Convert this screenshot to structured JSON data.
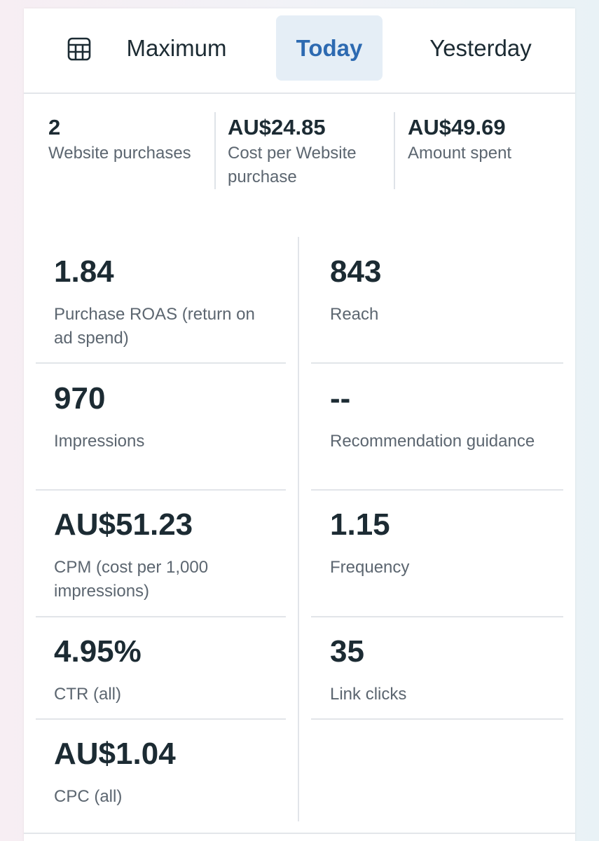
{
  "tabs": {
    "calendar_icon": "calendar-icon",
    "items": [
      {
        "label": "Maximum",
        "selected": false
      },
      {
        "label": "Today",
        "selected": true
      },
      {
        "label": "Yesterday",
        "selected": false
      }
    ],
    "selected_bg": "#e5eef6",
    "selected_color": "#2d6ab1"
  },
  "summary": [
    {
      "value": "2",
      "label": "Website purchases"
    },
    {
      "value": "AU$24.85",
      "label": "Cost per Website purchase"
    },
    {
      "value": "AU$49.69",
      "label": "Amount spent"
    }
  ],
  "metrics": {
    "left": [
      {
        "value": "1.84",
        "label": "Purchase ROAS (return on ad spend)"
      },
      {
        "value": "970",
        "label": "Impressions"
      },
      {
        "value": "AU$51.23",
        "label": "CPM (cost per 1,000 impressions)"
      },
      {
        "value": "4.95%",
        "label": "CTR (all)"
      },
      {
        "value": "AU$1.04",
        "label": "CPC (all)"
      }
    ],
    "right": [
      {
        "value": "843",
        "label": "Reach"
      },
      {
        "value": "--",
        "label": "Recommendation guidance"
      },
      {
        "value": "1.15",
        "label": "Frequency"
      },
      {
        "value": "35",
        "label": "Link clicks"
      }
    ]
  }
}
